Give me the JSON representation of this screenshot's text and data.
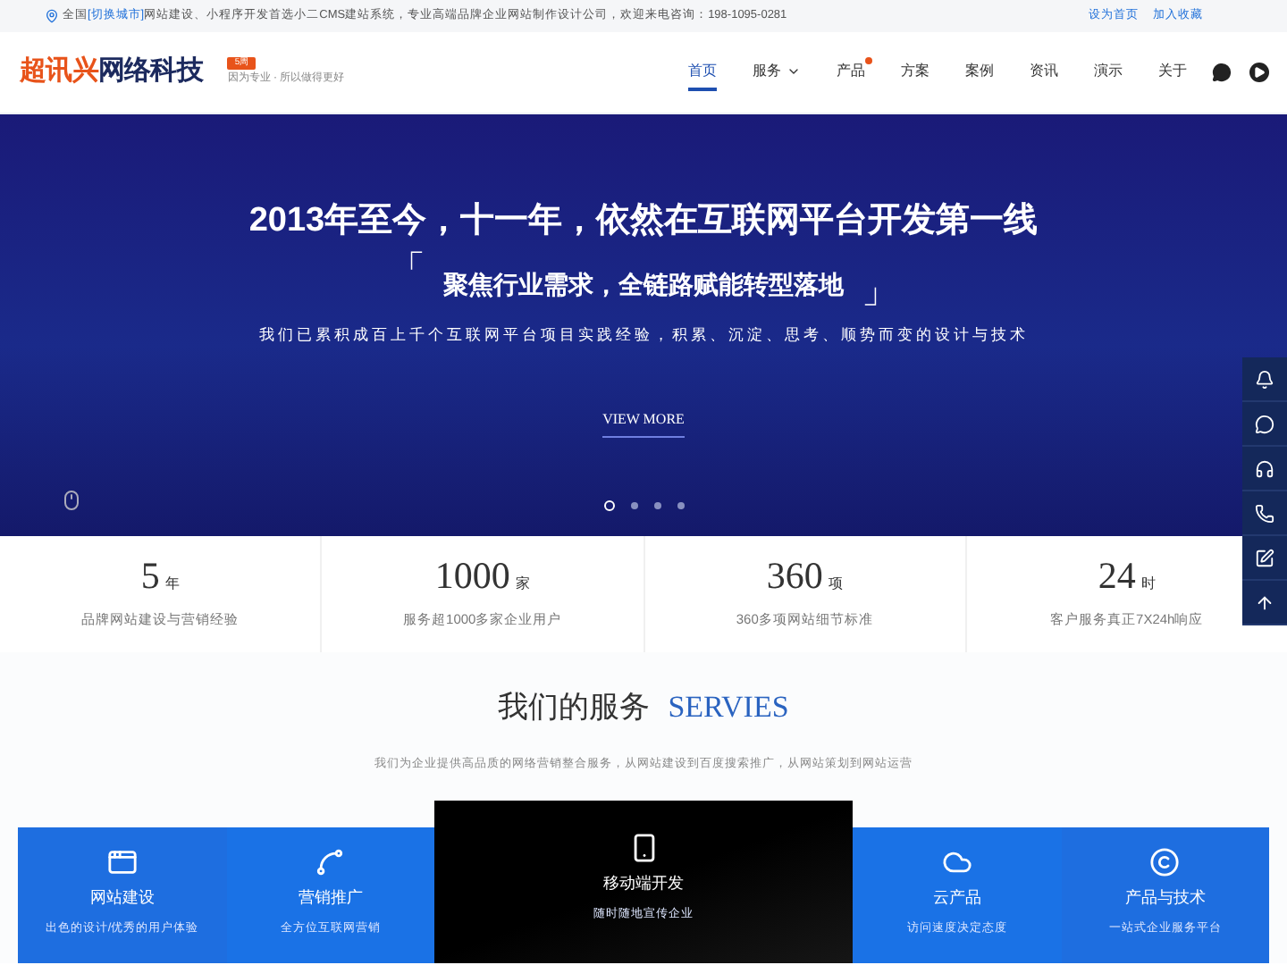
{
  "topbar": {
    "region": "全国",
    "city_link": "[切换城市]",
    "notice": "网站建设、小程序开发首选小二CMS建站系统，专业高端品牌企业网站制作设计公司，欢迎来电咨询：198-1095-0281",
    "links": [
      "设为首页",
      "加入收藏"
    ]
  },
  "logo": {
    "brand_a": "超讯兴",
    "brand_b": "网络科技",
    "badge": "5周",
    "tagline": "因为专业 · 所以做得更好"
  },
  "nav": [
    {
      "label": "首页",
      "selected": true,
      "dropdown": false,
      "dot": false
    },
    {
      "label": "服务",
      "selected": false,
      "dropdown": true,
      "dot": false
    },
    {
      "label": "产品",
      "selected": false,
      "dropdown": false,
      "dot": true
    },
    {
      "label": "方案",
      "selected": false,
      "dropdown": false,
      "dot": false
    },
    {
      "label": "案例",
      "selected": false,
      "dropdown": false,
      "dot": false
    },
    {
      "label": "资讯",
      "selected": false,
      "dropdown": false,
      "dot": false
    },
    {
      "label": "演示",
      "selected": false,
      "dropdown": false,
      "dot": false
    },
    {
      "label": "关于",
      "selected": false,
      "dropdown": false,
      "dot": false
    }
  ],
  "hero": {
    "title": "2013年至今，十一年，依然在互联网平台开发第一线",
    "quote_open": "「",
    "quote": "聚焦行业需求，全链路赋能转型落地",
    "quote_close": "」",
    "subtitle": "我们已累积成百上千个互联网平台项目实践经验，积累、沉淀、思考、顺势而变的设计与技术",
    "button": "VIEW MORE",
    "dots": [
      {
        "selected": true
      },
      {
        "selected": false
      },
      {
        "selected": false
      },
      {
        "selected": false
      }
    ]
  },
  "stats": [
    {
      "value": "5",
      "unit": "年",
      "caption": "品牌网站建设与营销经验"
    },
    {
      "value": "1000",
      "unit": "家",
      "caption": "服务超1000多家企业用户"
    },
    {
      "value": "360",
      "unit": "项",
      "caption": "360多项网站细节标准"
    },
    {
      "value": "24",
      "unit": "时",
      "caption": "客户服务真正7X24h响应"
    }
  ],
  "services": {
    "title": "我们的服务",
    "title_en": "SERVIES",
    "subtitle": "我们为企业提供高品质的网络营销整合服务，从网站建设到百度搜索推广，从网站策划到网站运营",
    "cards": [
      {
        "title": "网站建设",
        "caption": "出色的设计/优秀的用户体验",
        "selected": false
      },
      {
        "title": "营销推广",
        "caption": "全方位互联网营销",
        "selected": false
      },
      {
        "title": "移动端开发",
        "caption": "随时随地宣传企业",
        "selected": true
      },
      {
        "title": "云产品",
        "caption": "访问速度决定态度",
        "selected": false
      },
      {
        "title": "产品与技术",
        "caption": "一站式企业服务平台",
        "selected": false
      }
    ]
  }
}
